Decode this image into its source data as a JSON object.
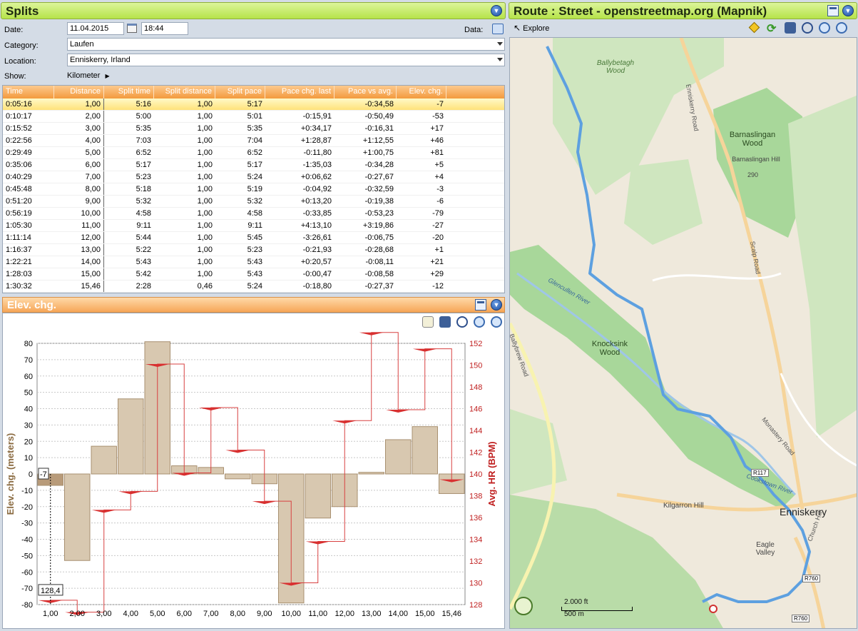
{
  "splits": {
    "title": "Splits",
    "date_label": "Date:",
    "date_value": "11.04.2015",
    "time_value": "18:44",
    "data_label": "Data:",
    "category_label": "Category:",
    "category_value": "Laufen",
    "location_label": "Location:",
    "location_value": "Enniskerry, Irland",
    "show_label": "Show:",
    "show_value": "Kilometer"
  },
  "table": {
    "columns": [
      "Time",
      "Distance",
      "Split time",
      "Split distance",
      "Split pace",
      "Pace chg. last",
      "Pace vs avg.",
      "Elev. chg."
    ],
    "rows": [
      [
        "0:05:16",
        "1,00",
        "5:16",
        "1,00",
        "5:17",
        "",
        "-0:34,58",
        "-7"
      ],
      [
        "0:10:17",
        "2,00",
        "5:00",
        "1,00",
        "5:01",
        "-0:15,91",
        "-0:50,49",
        "-53"
      ],
      [
        "0:15:52",
        "3,00",
        "5:35",
        "1,00",
        "5:35",
        "+0:34,17",
        "-0:16,31",
        "+17"
      ],
      [
        "0:22:56",
        "4,00",
        "7:03",
        "1,00",
        "7:04",
        "+1:28,87",
        "+1:12,55",
        "+46"
      ],
      [
        "0:29:49",
        "5,00",
        "6:52",
        "1,00",
        "6:52",
        "-0:11,80",
        "+1:00,75",
        "+81"
      ],
      [
        "0:35:06",
        "6,00",
        "5:17",
        "1,00",
        "5:17",
        "-1:35,03",
        "-0:34,28",
        "+5"
      ],
      [
        "0:40:29",
        "7,00",
        "5:23",
        "1,00",
        "5:24",
        "+0:06,62",
        "-0:27,67",
        "+4"
      ],
      [
        "0:45:48",
        "8,00",
        "5:18",
        "1,00",
        "5:19",
        "-0:04,92",
        "-0:32,59",
        "-3"
      ],
      [
        "0:51:20",
        "9,00",
        "5:32",
        "1,00",
        "5:32",
        "+0:13,20",
        "-0:19,38",
        "-6"
      ],
      [
        "0:56:19",
        "10,00",
        "4:58",
        "1,00",
        "4:58",
        "-0:33,85",
        "-0:53,23",
        "-79"
      ],
      [
        "1:05:30",
        "11,00",
        "9:11",
        "1,00",
        "9:11",
        "+4:13,10",
        "+3:19,86",
        "-27"
      ],
      [
        "1:11:14",
        "12,00",
        "5:44",
        "1,00",
        "5:45",
        "-3:26,61",
        "-0:06,75",
        "-20"
      ],
      [
        "1:16:37",
        "13,00",
        "5:22",
        "1,00",
        "5:23",
        "-0:21,93",
        "-0:28,68",
        "+1"
      ],
      [
        "1:22:21",
        "14,00",
        "5:43",
        "1,00",
        "5:43",
        "+0:20,57",
        "-0:08,11",
        "+21"
      ],
      [
        "1:28:03",
        "15,00",
        "5:42",
        "1,00",
        "5:43",
        "-0:00,47",
        "-0:08,58",
        "+29"
      ],
      [
        "1:30:32",
        "15,46",
        "2:28",
        "0,46",
        "5:24",
        "-0:18,80",
        "-0:27,37",
        "-12"
      ]
    ]
  },
  "elev_panel": {
    "title": "Elev. chg."
  },
  "chart_data": {
    "type": "bar",
    "categories": [
      "1,00",
      "2,00",
      "3,00",
      "4,00",
      "5,00",
      "6,00",
      "7,00",
      "8,00",
      "9,00",
      "10,00",
      "11,00",
      "12,00",
      "13,00",
      "14,00",
      "15,00",
      "15,46"
    ],
    "series": [
      {
        "name": "Elev. chg. (meters)",
        "values": [
          -7,
          -53,
          17,
          46,
          81,
          5,
          4,
          -3,
          -6,
          -79,
          -27,
          -20,
          1,
          21,
          29,
          -12
        ]
      },
      {
        "name": "Avg. HR (BPM)",
        "values": [
          128.4,
          127.3,
          136.7,
          138.4,
          150.1,
          140.1,
          146.1,
          142.2,
          137.5,
          130.0,
          133.8,
          144.9,
          153.0,
          145.9,
          151.5,
          139.5
        ]
      }
    ],
    "ylabel": "Elev. chg. (meters)",
    "y2label": "Avg. HR (BPM)",
    "ylim": [
      -80,
      80
    ],
    "y2lim": [
      128,
      152
    ],
    "yticks": [
      "80",
      "70",
      "60",
      "50",
      "40",
      "30",
      "20",
      "10",
      "0",
      "-10",
      "-20",
      "-30",
      "-40",
      "-50",
      "-60",
      "-70",
      "-80"
    ],
    "y2ticks": [
      "152",
      "150",
      "148",
      "146",
      "144",
      "142",
      "140",
      "138",
      "136",
      "134",
      "132",
      "130",
      "128"
    ],
    "cursor_value": "-7",
    "cursor_hr": "128,4"
  },
  "route": {
    "title": "Route : Street - openstreetmap.org (Mapnik)",
    "explore_label": "Explore"
  },
  "map": {
    "labels": [
      "Ballybetagh Wood",
      "Enniskerry Road",
      "Barnaslingan Wood",
      "Barnaslingan Hill",
      "290",
      "Scalp Road",
      "Glencullen River",
      "Knocksink Wood",
      "Ballybrew Road",
      "Monastery Road",
      "Cookstown River",
      "Kilgarron Hill",
      "Enniskerry",
      "Eagle Valley",
      "Church Hill",
      "R117",
      "R760",
      "R760"
    ],
    "scale_ft": "2.000 ft",
    "scale_m": "500 m"
  },
  "colors": {
    "bar_fill": "#d8c8b0",
    "bar_stroke": "#a89070",
    "hr_line": "#d84040",
    "route": "#5da0e0",
    "wood": "#a8d79a"
  }
}
